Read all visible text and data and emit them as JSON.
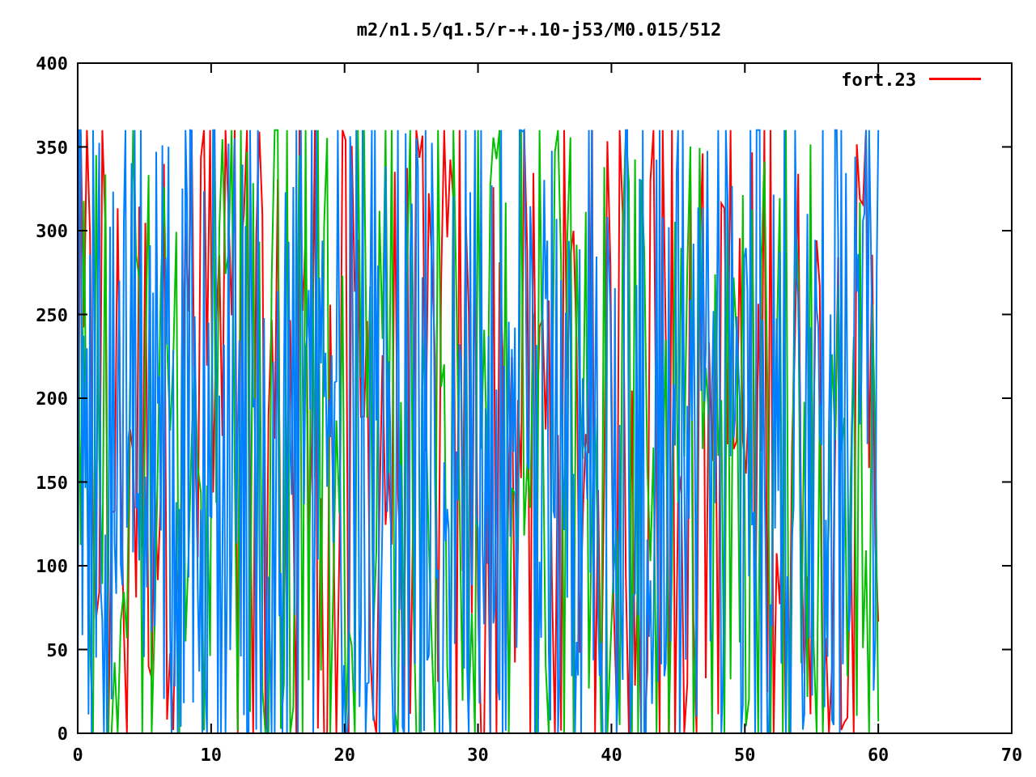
{
  "title": "m2/n1.5/q1.5/r-+.10-j53/M0.015/512",
  "legend": [
    {
      "label": "fort.23",
      "color": "#ff0000"
    }
  ],
  "traces": [
    {
      "color": "#ff0000"
    },
    {
      "color": "#00c000"
    },
    {
      "color": "#0080ff"
    }
  ],
  "xticks": [
    "0",
    "10",
    "20",
    "30",
    "40",
    "50",
    "60",
    "70"
  ],
  "yticks": [
    "400",
    "350",
    "300",
    "250",
    "200",
    "150",
    "100",
    "50",
    "0"
  ]
}
